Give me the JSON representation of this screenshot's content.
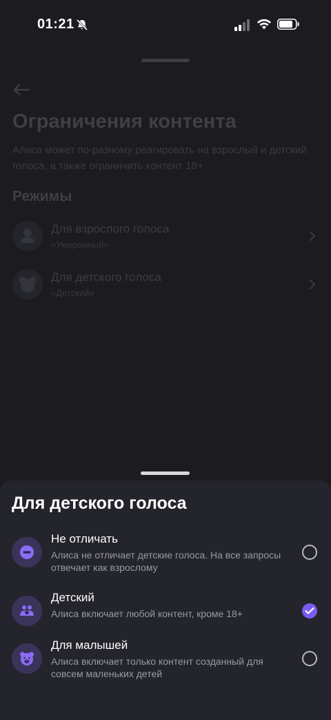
{
  "status_bar": {
    "time": "01:21"
  },
  "background_page": {
    "title": "Ограничения контента",
    "description": "Алиса может по-разному реагировать на взрослый и детский голоса, а также ограничить контент 18+",
    "section_title": "Режимы",
    "rows": [
      {
        "title": "Для взрослого голоса",
        "subtitle": "«Умеренный»",
        "icon": "person-icon"
      },
      {
        "title": "Для детского голоса",
        "subtitle": "«Детский»",
        "icon": "bear-icon"
      }
    ]
  },
  "sheet": {
    "title": "Для детского голоса",
    "options": [
      {
        "title": "Не отличать",
        "subtitle": "Алиса не отличает детские голоса. На все запросы отвечает как взрослому",
        "icon": "minus-circle-icon",
        "selected": false
      },
      {
        "title": "Детский",
        "subtitle": "Алиса включает любой контент, кроме 18+",
        "icon": "children-icon",
        "selected": true
      },
      {
        "title": "Для малышей",
        "subtitle": "Алиса включает только контент созданный для совсем маленьких детей",
        "icon": "bear-icon",
        "selected": false
      }
    ]
  },
  "colors": {
    "accent": "#7b5cf0",
    "icon_bg": "#3b345a",
    "sheet_bg": "#24242c",
    "page_bg": "#1b1b20"
  }
}
